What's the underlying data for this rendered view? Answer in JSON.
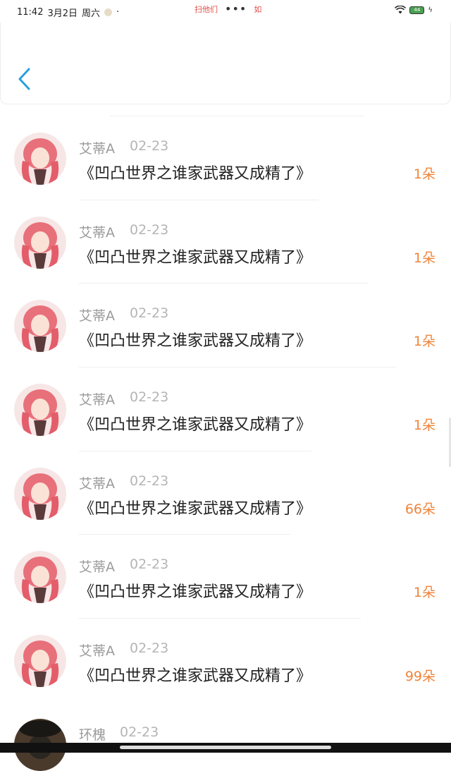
{
  "status_bar": {
    "time": "11:42",
    "date": "3月2日",
    "weekday": "周六",
    "center_left": "扫他们",
    "center_right": "如",
    "center_dots": "•••",
    "battery": "44"
  },
  "header": {
    "back_icon": "chevron-left-icon",
    "accent": "#2a9fe0"
  },
  "records": [
    {
      "name": "艾蒂A",
      "date": "02-23",
      "title": "《凹凸世界之谁家武器又成精了》",
      "amount": "1朵"
    },
    {
      "name": "艾蒂A",
      "date": "02-23",
      "title": "《凹凸世界之谁家武器又成精了》",
      "amount": "1朵"
    },
    {
      "name": "艾蒂A",
      "date": "02-23",
      "title": "《凹凸世界之谁家武器又成精了》",
      "amount": "1朵"
    },
    {
      "name": "艾蒂A",
      "date": "02-23",
      "title": "《凹凸世界之谁家武器又成精了》",
      "amount": "1朵"
    },
    {
      "name": "艾蒂A",
      "date": "02-23",
      "title": "《凹凸世界之谁家武器又成精了》",
      "amount": "66朵"
    },
    {
      "name": "艾蒂A",
      "date": "02-23",
      "title": "《凹凸世界之谁家武器又成精了》",
      "amount": "1朵"
    },
    {
      "name": "艾蒂A",
      "date": "02-23",
      "title": "《凹凸世界之谁家武器又成精了》",
      "amount": "99朵"
    }
  ],
  "last_record": {
    "name": "环槐",
    "date": "02-23"
  },
  "colors": {
    "amount": "#f0843a",
    "meta": "#9a9a9a"
  }
}
